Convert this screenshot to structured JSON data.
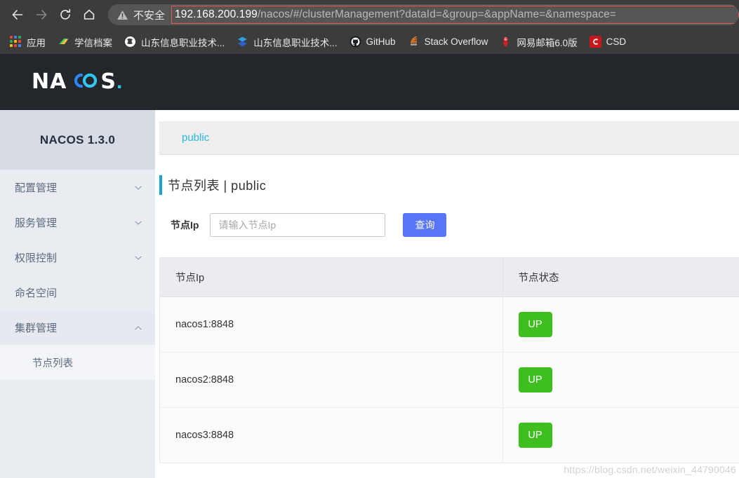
{
  "browser": {
    "nav": {
      "back": "back-arrow",
      "forward": "forward-arrow",
      "reload": "reload",
      "home": "home"
    },
    "security": {
      "icon": "warning-triangle-icon",
      "label": "不安全"
    },
    "url": {
      "host": "192.168.200.199",
      "path": "/nacos/#/clusterManagement?dataId=&group=&appName=&namespace=",
      "full": "192.168.200.199/nacos/#/clusterManagement?dataId=&group=&appName=&namespace="
    },
    "bookmarks": [
      {
        "label": "应用",
        "icon": "apps-grid-icon",
        "color": "#4285f4"
      },
      {
        "label": "学信档案",
        "icon": "chsi-icon",
        "color": "#1bb66e"
      },
      {
        "label": "山东信息职业技术...",
        "icon": "globe-icon",
        "color": "#ffffff"
      },
      {
        "label": "山东信息职业技术...",
        "icon": "cube-icon",
        "color": "#2f6fdb"
      },
      {
        "label": "GitHub",
        "icon": "github-icon",
        "color": "#24292e"
      },
      {
        "label": "Stack Overflow",
        "icon": "stackoverflow-icon",
        "color": "#f48024"
      },
      {
        "label": "网易邮箱6.0版",
        "icon": "netease-mail-icon",
        "color": "#d91d22"
      },
      {
        "label": "CSD",
        "icon": "csdn-icon",
        "color": "#c8161d"
      }
    ]
  },
  "app": {
    "logo": {
      "part1": "NA",
      "part2": "CO",
      "part3": "S",
      "dot": "."
    },
    "sidebar": {
      "version_title": "NACOS 1.3.0",
      "items": [
        {
          "label": "配置管理",
          "expandable": true,
          "expanded": false,
          "chevron": "chevron-down-icon"
        },
        {
          "label": "服务管理",
          "expandable": true,
          "expanded": false,
          "chevron": "chevron-down-icon"
        },
        {
          "label": "权限控制",
          "expandable": true,
          "expanded": false,
          "chevron": "chevron-down-icon"
        },
        {
          "label": "命名空间",
          "expandable": false,
          "expanded": false,
          "chevron": ""
        },
        {
          "label": "集群管理",
          "expandable": true,
          "expanded": true,
          "chevron": "chevron-up-icon"
        }
      ],
      "sub_items": [
        {
          "label": "节点列表",
          "active": true
        }
      ]
    },
    "main": {
      "breadcrumb": "public",
      "page_title": "节点列表  |  public",
      "search": {
        "label": "节点Ip",
        "placeholder": "请输入节点Ip",
        "value": "",
        "button_label": "查询"
      },
      "table": {
        "columns": [
          "节点Ip",
          "节点状态"
        ],
        "rows": [
          {
            "ip": "nacos1:8848",
            "status": "UP"
          },
          {
            "ip": "nacos2:8848",
            "status": "UP"
          },
          {
            "ip": "nacos3:8848",
            "status": "UP"
          }
        ]
      },
      "watermark": "https://blog.csdn.net/weixin_44790046"
    }
  },
  "colors": {
    "chrome_bg": "#3c3c3c",
    "omnibox_bg": "#555555",
    "url_outline": "#e05d53",
    "header_bg": "#23272b",
    "logo_accent": "#31c5f4",
    "sidebar_title_bg": "#d6dbe4",
    "sidebar_bg": "#e9edf2",
    "breadcrumb_link": "#29b8e4",
    "title_accent": "#1da0d8",
    "primary_button": "#5975f5",
    "status_up": "#3fbe1f"
  }
}
